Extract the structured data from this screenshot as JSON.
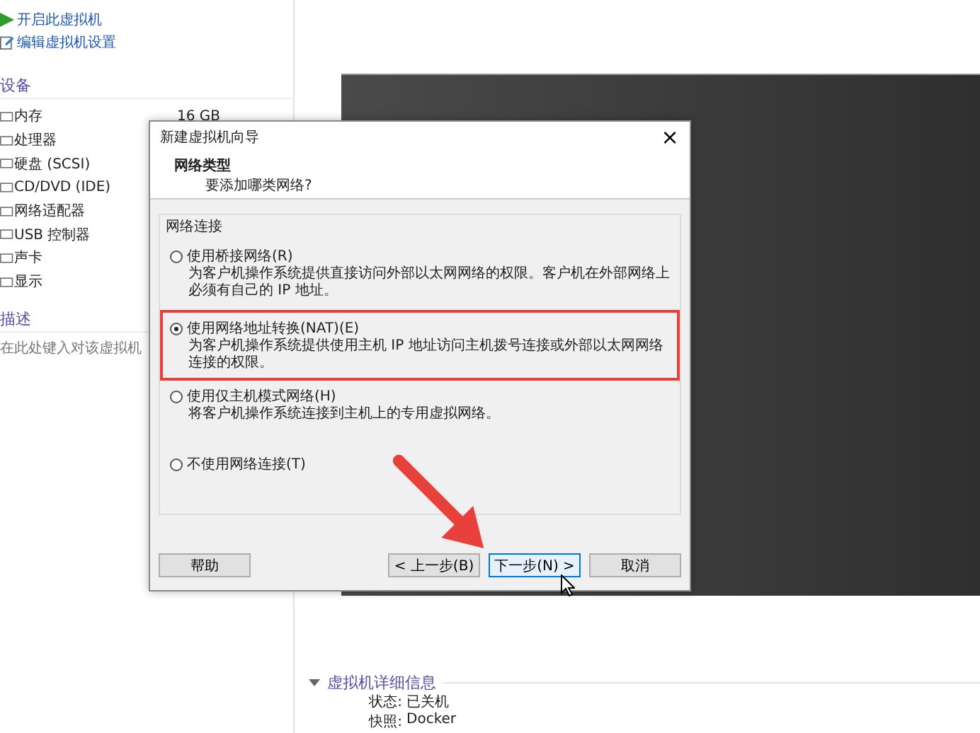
{
  "sidebar": {
    "actions": [
      {
        "label": "开启此虚拟机",
        "kind": "play"
      },
      {
        "label": "编辑虚拟机设置",
        "kind": "edit"
      }
    ],
    "devices_heading": "设备",
    "devices": [
      {
        "name": "内存",
        "value": "16 GB"
      },
      {
        "name": "处理器"
      },
      {
        "name": "硬盘 (SCSI)"
      },
      {
        "name": "CD/DVD (IDE)"
      },
      {
        "name": "网络适配器"
      },
      {
        "name": "USB 控制器"
      },
      {
        "name": "声卡"
      },
      {
        "name": "显示"
      }
    ],
    "description_heading": "描述",
    "description_placeholder": "在此处键入对该虚拟机"
  },
  "details": {
    "heading": "虚拟机详细信息",
    "expanded": true,
    "rows": [
      {
        "label": "状态:",
        "value": "已关机"
      },
      {
        "label": "快照:",
        "value": "Docker"
      }
    ]
  },
  "dialog": {
    "title": "新建虚拟机向导",
    "close": "×",
    "heading": "网络类型",
    "subheading": "要添加哪类网络?",
    "group_label": "网络连接",
    "options": [
      {
        "label": "使用桥接网络(R)",
        "description": "为客户机操作系统提供直接访问外部以太网网络的权限。客户机在外部网络上必须有自己的 IP 地址。",
        "selected": false,
        "highlighted": false
      },
      {
        "label": "使用网络地址转换(NAT)(E)",
        "description": "为客户机操作系统提供使用主机 IP 地址访问主机拨号连接或外部以太网网络连接的权限。",
        "selected": true,
        "highlighted": true
      },
      {
        "label": "使用仅主机模式网络(H)",
        "description": "将客户机操作系统连接到主机上的专用虚拟网络。",
        "selected": false,
        "highlighted": false
      },
      {
        "label": "不使用网络连接(T)",
        "selected": false,
        "highlighted": false
      }
    ],
    "help_button": "帮助",
    "buttons": [
      {
        "label": "< 上一步(B)",
        "default": false
      },
      {
        "label": "下一步(N) >",
        "default": true
      },
      {
        "label": "取消",
        "default": false
      }
    ]
  }
}
